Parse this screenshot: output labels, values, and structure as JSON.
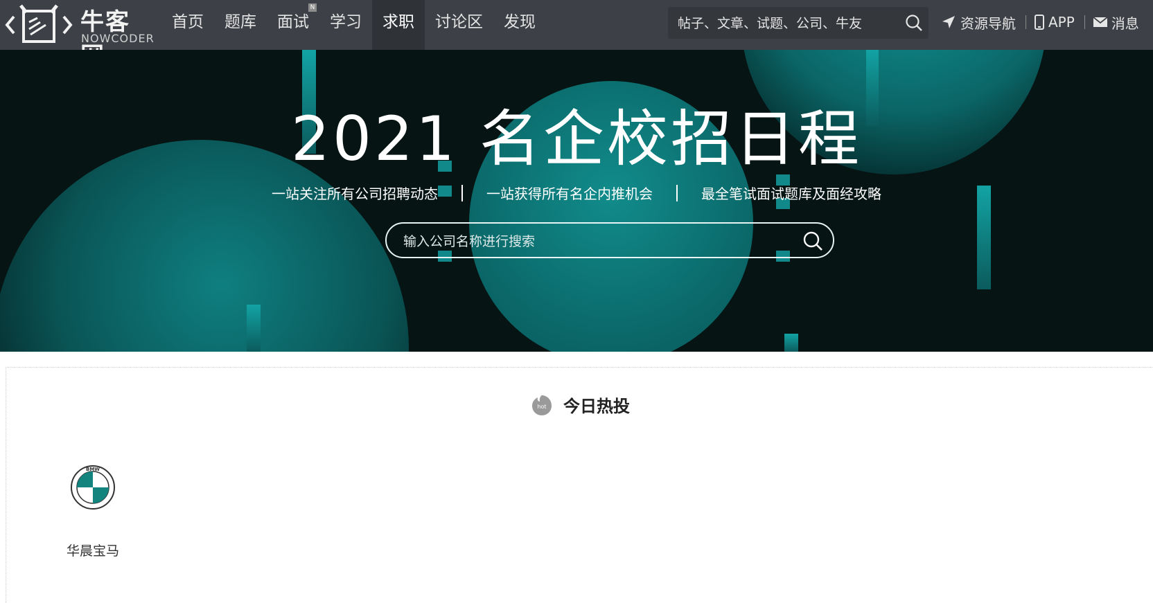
{
  "header": {
    "logo_cn": "牛客网",
    "logo_en": "NOWCODER",
    "nav": [
      {
        "label": "首页"
      },
      {
        "label": "题库"
      },
      {
        "label": "面试",
        "badge": "N"
      },
      {
        "label": "学习"
      },
      {
        "label": "求职",
        "active": true
      },
      {
        "label": "讨论区"
      },
      {
        "label": "发现"
      }
    ],
    "search_placeholder": "帖子、文章、试题、公司、牛友",
    "links": {
      "resources": "资源导航",
      "app": "APP",
      "messages": "消息"
    }
  },
  "banner": {
    "title": "2021 名企校招日程",
    "slogans": [
      "一站关注所有公司招聘动态",
      "一站获得所有名企内推机会",
      "最全笔试面试题库及面经攻略"
    ],
    "search_placeholder": "输入公司名称进行搜索"
  },
  "hot": {
    "icon_text": "hot",
    "title": "今日热投",
    "companies": [
      {
        "name": "华晨宝马",
        "logo_text": "BMW"
      }
    ]
  },
  "colors": {
    "nav_bg": "#3d4046",
    "banner_accent": "#0e8a8a",
    "banner_dark": "#061414"
  }
}
